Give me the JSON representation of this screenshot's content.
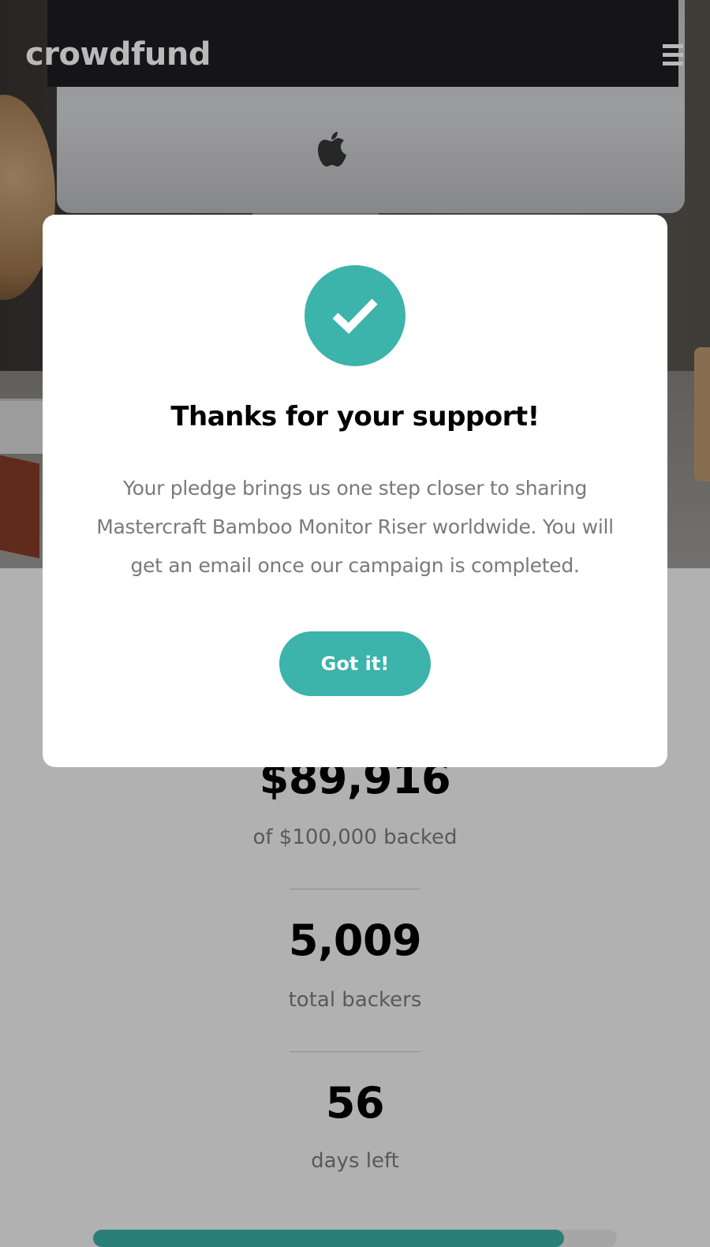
{
  "header": {
    "logo_text": "crowdfund",
    "menu_icon": "hamburger-menu-icon"
  },
  "hero": {
    "image_icon": "imac-desk-photo",
    "brand_mark_icon": "apple-logo-icon"
  },
  "modal": {
    "icon": "check-icon",
    "title": "Thanks for your support!",
    "message": "Your pledge brings us one step closer to sharing Mastercraft Bamboo Monitor Riser worldwide. You will get an email once our campaign is completed.",
    "button_label": "Got it!"
  },
  "stats": {
    "amount_backed": "$89,916",
    "amount_backed_label": "of $100,000 backed",
    "total_backers": "5,009",
    "total_backers_label": "total backers",
    "days_left": "56",
    "days_left_label": "days left",
    "progress_fraction": 0.899
  },
  "colors": {
    "accent": "#3cb3ab",
    "accent_dark": "#2a7f78",
    "overlay": "#b1b1b1"
  }
}
